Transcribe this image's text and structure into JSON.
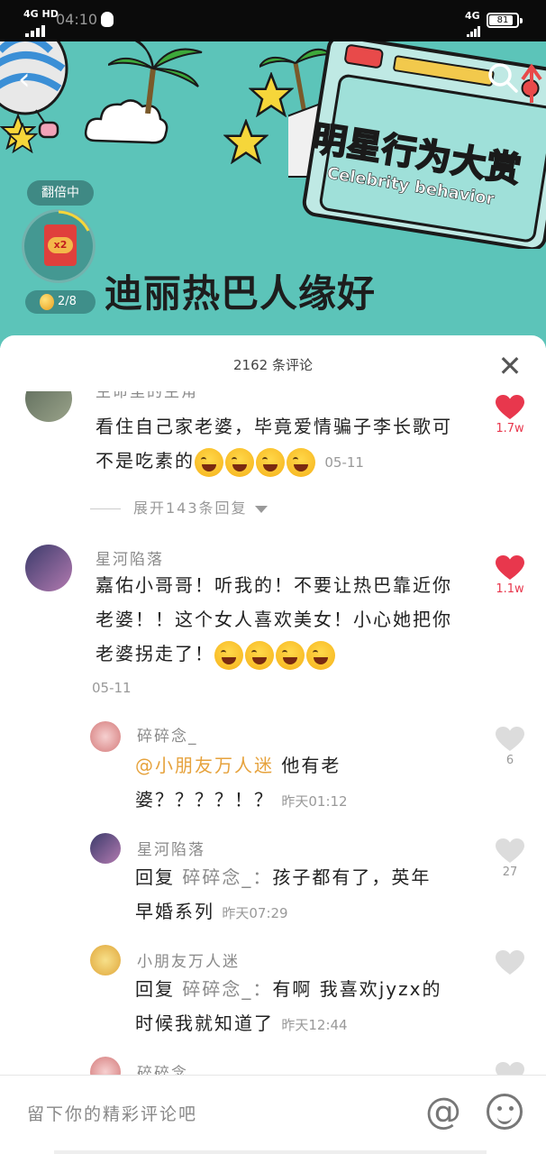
{
  "status_bar": {
    "network_left": "4G HD",
    "time": "04:10",
    "network_right": "4G",
    "battery": "81"
  },
  "banner": {
    "title_cn": "明星行为大赏",
    "title_en": "Celebrity behavior",
    "hashtag": "迪丽热巴人缘好",
    "redeem_status": "翻倍中",
    "multiplier": "x2",
    "coin_progress": "2/8"
  },
  "sheet": {
    "comment_count": "2162 条评论"
  },
  "comments": [
    {
      "username": "生命里的主角",
      "text": "看住自己家老婆，毕竟爱情骗子李长歌可不是吃素的",
      "emoji_count": 4,
      "time": "05-11",
      "likes": "1.7w",
      "liked": true,
      "expand_label": "展开143条回复"
    },
    {
      "username": "星河陷落",
      "text": "嘉佑小哥哥！听我的！不要让热巴靠近你老婆！！这个女人喜欢美女！小心她把你老婆拐走了！",
      "emoji_count": 4,
      "time": "05-11",
      "likes": "1.1w",
      "liked": true,
      "replies": [
        {
          "username": "碎碎念_",
          "mention": "@小朋友万人迷",
          "text_line1": "他有老",
          "text_line2": "婆？？？？！？",
          "time": "昨天01:12",
          "likes": "6"
        },
        {
          "username": "星河陷落",
          "reply_prefix": "回复",
          "reply_target": "碎碎念_：",
          "text_line1": "孩子都有了，英年",
          "text_line2": "早婚系列",
          "time": "昨天07:29",
          "likes": "27"
        },
        {
          "username": "小朋友万人迷",
          "reply_prefix": "回复",
          "reply_target": "碎碎念_：",
          "text_line1": "有啊 我喜欢jyzx的",
          "text_line2": "时候我就知道了",
          "time": "昨天12:44",
          "likes": ""
        },
        {
          "username": "碎碎念",
          "likes": ""
        }
      ]
    }
  ],
  "input": {
    "placeholder": "留下你的精彩评论吧",
    "at_symbol": "@"
  },
  "colors": {
    "banner_bg": "#5cc4b9",
    "like_red": "#e8374d",
    "mention": "#e6a23c"
  },
  "icons": [
    "back-arrow-icon",
    "search-icon",
    "close-icon",
    "heart-icon",
    "at-icon",
    "emoji-icon",
    "red-envelope-icon",
    "coin-icon"
  ]
}
